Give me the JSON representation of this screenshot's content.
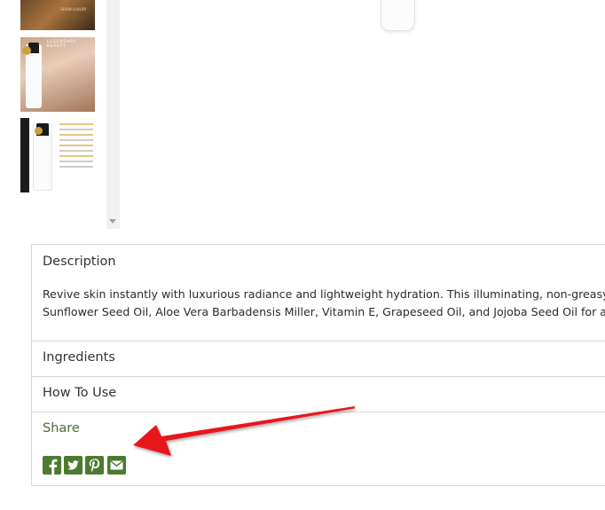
{
  "thumbnails": [
    {
      "name": "thumb-1",
      "caption": "SHOW LUXURY"
    },
    {
      "name": "thumb-2",
      "caption": "LEGENDARY BEAUTY"
    },
    {
      "name": "thumb-3",
      "caption": ""
    }
  ],
  "accordion": {
    "description": {
      "title": "Description",
      "line1": "Revive skin instantly with luxurious radiance and lightweight hydration. This illuminating, non-greasy",
      "line2": "Sunflower Seed Oil, Aloe Vera Barbadensis Miller, Vitamin E, Grapeseed Oil, and Jojoba Seed Oil for a"
    },
    "ingredients": {
      "title": "Ingredients"
    },
    "how_to_use": {
      "title": "How To Use"
    },
    "share": {
      "title": "Share",
      "icons": [
        "facebook-icon",
        "twitter-icon",
        "pinterest-icon",
        "email-icon"
      ]
    }
  },
  "colors": {
    "share_green": "#4d7a31",
    "share_title": "#4f6a34",
    "arrow_red": "#e8191b"
  }
}
